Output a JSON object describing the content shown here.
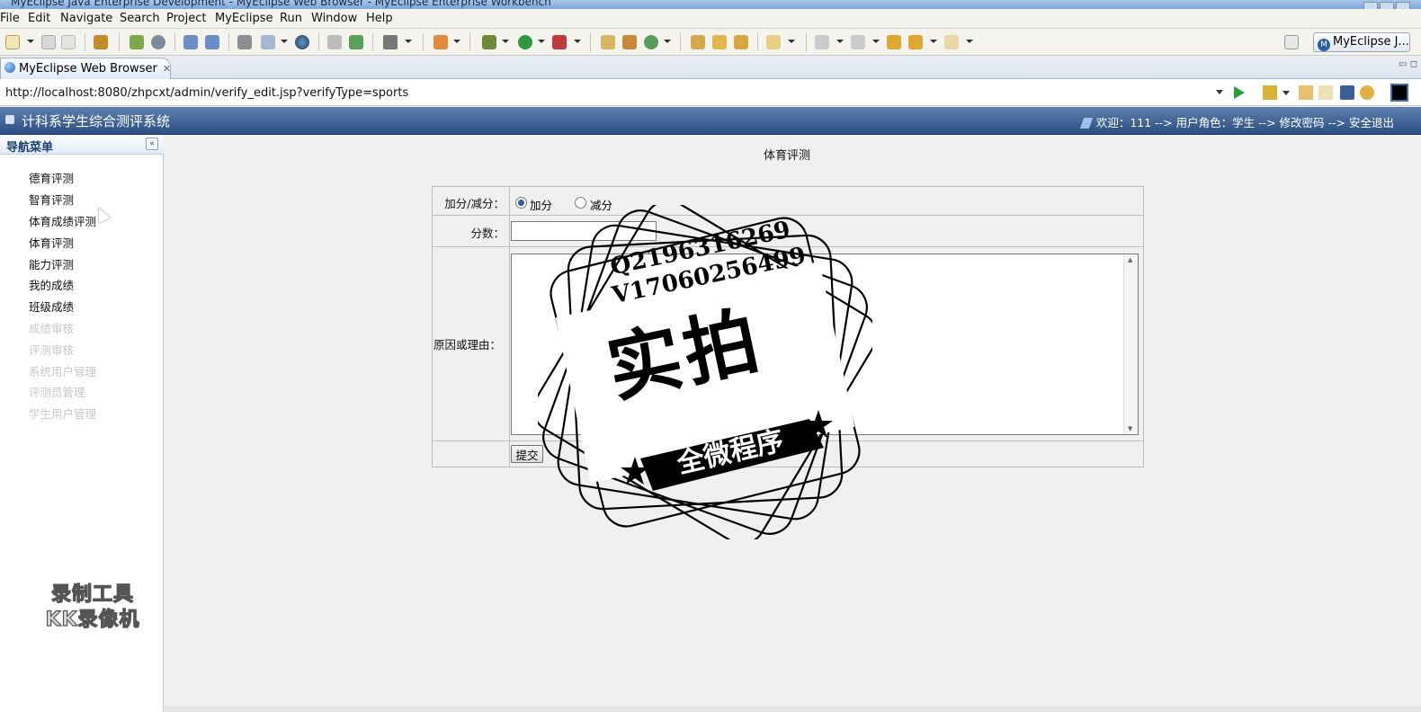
{
  "window": {
    "title": "MyEclipse Java Enterprise Development - MyEclipse Web Browser - MyEclipse Enterprise Workbench"
  },
  "menu": [
    "File",
    "Edit",
    "Navigate",
    "Search",
    "Project",
    "MyEclipse",
    "Run",
    "Window",
    "Help"
  ],
  "perspective_button": "MyEclipse J...",
  "editor_tab": {
    "label": "MyEclipse Web Browser"
  },
  "browser": {
    "url": "http://localhost:8080/zhpcxt/admin/verify_edit.jsp?verifyType=sports"
  },
  "app": {
    "title": "计科系学生综合测评系统",
    "user_bar": "欢迎：111 --> 用户角色：学生 --> 修改密码 --> 安全退出"
  },
  "sidebar": {
    "title": "导航菜单",
    "collapse_label": "«",
    "items": [
      {
        "label": "德育评测",
        "enabled": true
      },
      {
        "label": "智育评测",
        "enabled": true
      },
      {
        "label": "体育成绩评测",
        "enabled": true
      },
      {
        "label": "体育评测",
        "enabled": true
      },
      {
        "label": "能力评测",
        "enabled": true
      },
      {
        "label": "我的成绩",
        "enabled": true
      },
      {
        "label": "班级成绩",
        "enabled": true
      },
      {
        "label": "成绩审核",
        "enabled": false
      },
      {
        "label": "评测审核",
        "enabled": false
      },
      {
        "label": "系统用户管理",
        "enabled": false
      },
      {
        "label": "评测员管理",
        "enabled": false
      },
      {
        "label": "学生用户管理",
        "enabled": false
      }
    ]
  },
  "main": {
    "heading": "体育评测",
    "form": {
      "type_label": "加分/减分：",
      "add_label": "加分",
      "subtract_label": "减分",
      "selected": "加分",
      "score_label": "分数：",
      "score_value": "",
      "reason_label": "原因或理由：",
      "reason_value": "",
      "submit_label": "提交"
    }
  },
  "overlays": {
    "kk_watermark": [
      "录制工具",
      "KK录像机"
    ],
    "stamp": {
      "line1": "Q2196316269",
      "line2": "V17060256499",
      "big": "实拍",
      "banner": "全微程序"
    }
  },
  "colors": {
    "header_blue": "#2d4e82",
    "sidebar_title": "#1d3f72",
    "radio_selected": "#2c5fa9"
  }
}
